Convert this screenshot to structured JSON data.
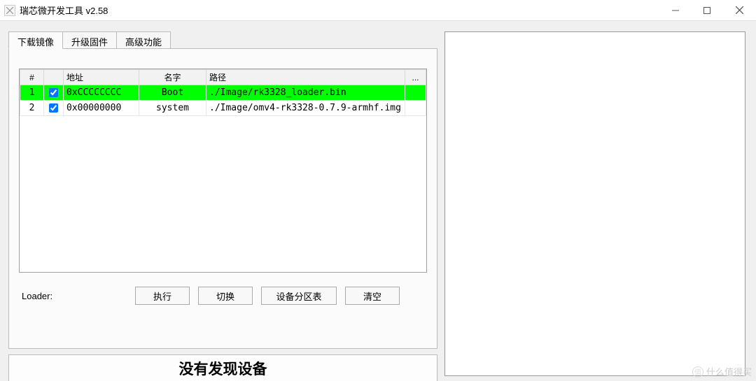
{
  "window": {
    "title": "瑞芯微开发工具 v2.58"
  },
  "tabs": [
    {
      "label": "下载镜像",
      "active": true
    },
    {
      "label": "升级固件",
      "active": false
    },
    {
      "label": "高级功能",
      "active": false
    }
  ],
  "table": {
    "headers": {
      "num": "#",
      "check": "",
      "address": "地址",
      "name": "名字",
      "path": "路径",
      "extra": "..."
    },
    "rows": [
      {
        "num": "1",
        "checked": true,
        "address": "0xCCCCCCCC",
        "name": "Boot",
        "path": "./Image/rk3328_loader.bin",
        "selected": true
      },
      {
        "num": "2",
        "checked": true,
        "address": "0x00000000",
        "name": "system",
        "path": "./Image/omv4-rk3328-0.7.9-armhf.img",
        "selected": false
      }
    ]
  },
  "loader": {
    "label": "Loader:"
  },
  "buttons": {
    "execute": "执行",
    "switch": "切换",
    "partition": "设备分区表",
    "clear": "清空"
  },
  "status": {
    "text": "没有发现设备"
  },
  "watermark": {
    "text": "什么值得买"
  }
}
